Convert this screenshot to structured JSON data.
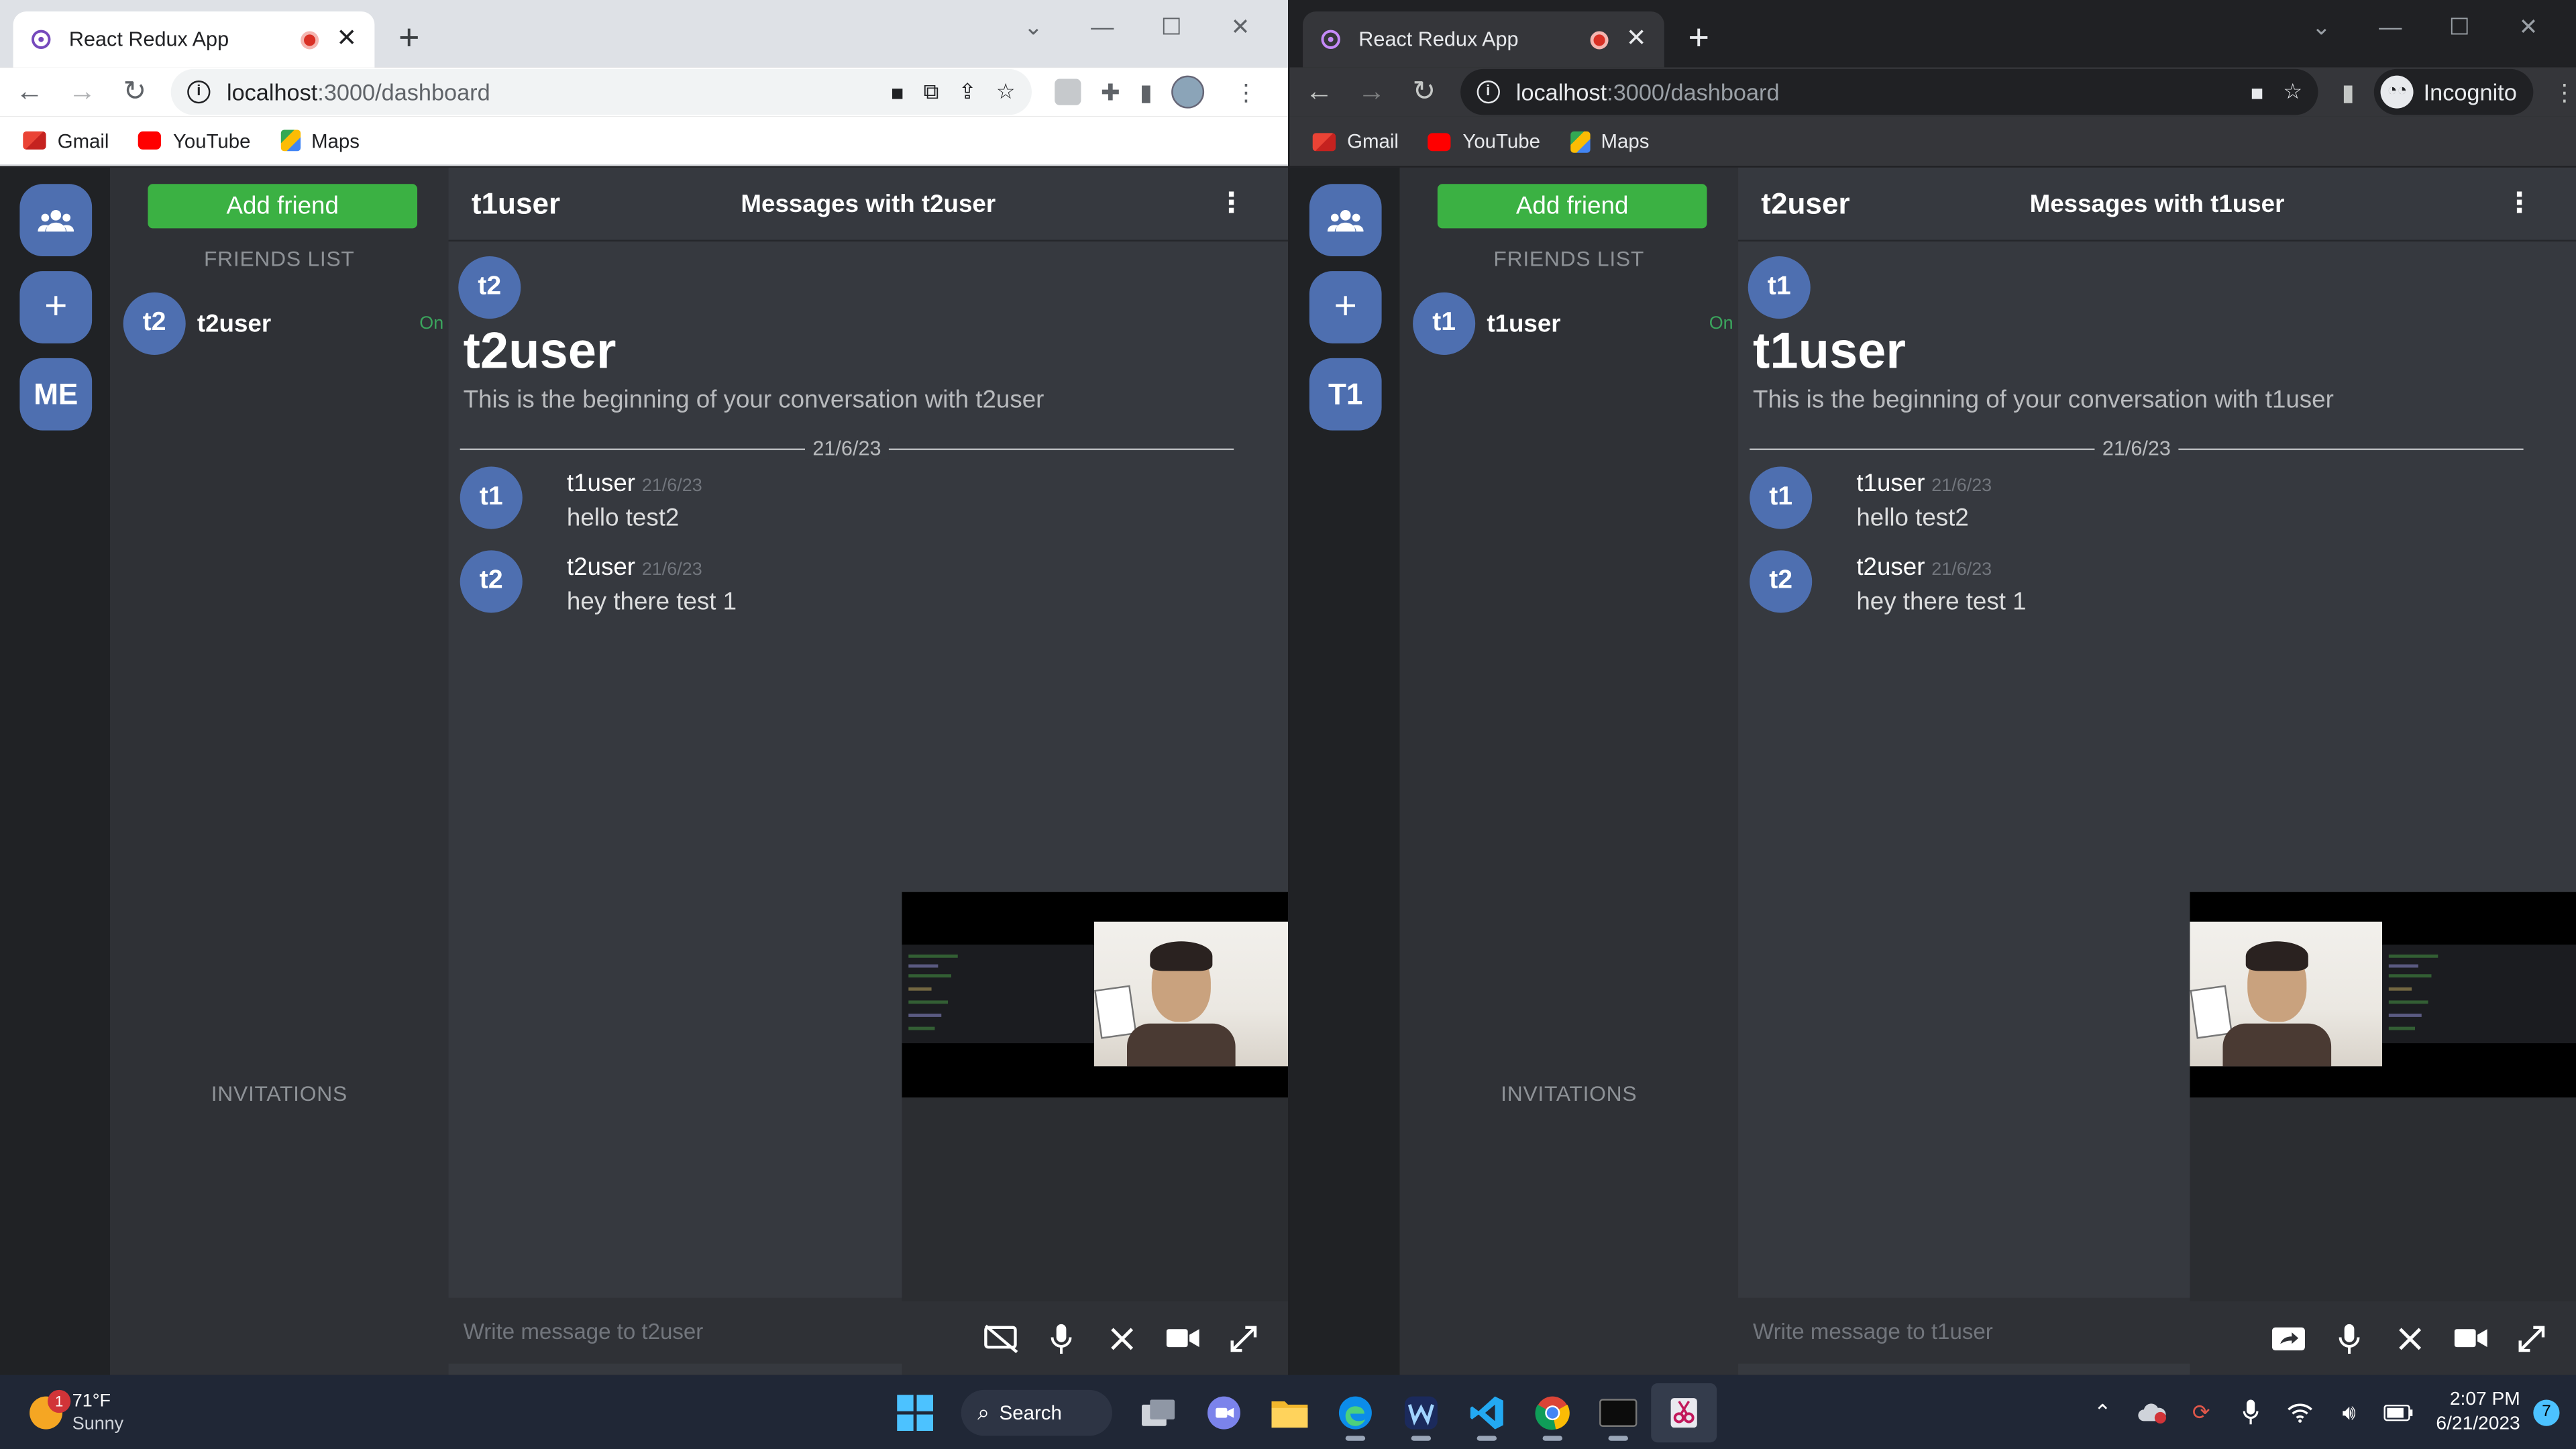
{
  "browser": [
    {
      "tab_title": "React Redux App",
      "url_host": "localhost",
      "url_path": ":3000/dashboard",
      "incognito_label": "",
      "bookmarks": [
        {
          "label": "Gmail",
          "icon": "gmail-icon"
        },
        {
          "label": "YouTube",
          "icon": "youtube-icon"
        },
        {
          "label": "Maps",
          "icon": "maps-icon"
        }
      ],
      "app": {
        "rail_me": "ME",
        "add_friend": "Add friend",
        "friends_list_title": "FRIENDS LIST",
        "friend": {
          "avatar": "t2",
          "name": "t2user",
          "status": "On"
        },
        "invitations_title": "INVITATIONS",
        "header_user": "t1user",
        "header_title": "Messages with t2user",
        "intro_avatar": "t2",
        "intro_name": "t2user",
        "intro_sub": "This is the beginning of your conversation with t2user",
        "divider_date": "21/6/23",
        "messages": [
          {
            "avatar": "t1",
            "author": "t1user",
            "date": "21/6/23",
            "text": "hello test2"
          },
          {
            "avatar": "t2",
            "author": "t2user",
            "date": "21/6/23",
            "text": "hey there test 1"
          }
        ],
        "composer_placeholder": "Write message to t2user"
      }
    },
    {
      "tab_title": "React Redux App",
      "url_host": "localhost",
      "url_path": ":3000/dashboard",
      "incognito_label": "Incognito",
      "bookmarks": [
        {
          "label": "Gmail",
          "icon": "gmail-icon"
        },
        {
          "label": "YouTube",
          "icon": "youtube-icon"
        },
        {
          "label": "Maps",
          "icon": "maps-icon"
        }
      ],
      "app": {
        "rail_me": "T1",
        "add_friend": "Add friend",
        "friends_list_title": "FRIENDS LIST",
        "friend": {
          "avatar": "t1",
          "name": "t1user",
          "status": "On"
        },
        "invitations_title": "INVITATIONS",
        "header_user": "t2user",
        "header_title": "Messages with t1user",
        "intro_avatar": "t1",
        "intro_name": "t1user",
        "intro_sub": "This is the beginning of your conversation with t1user",
        "divider_date": "21/6/23",
        "messages": [
          {
            "avatar": "t1",
            "author": "t1user",
            "date": "21/6/23",
            "text": "hello test2"
          },
          {
            "avatar": "t2",
            "author": "t2user",
            "date": "21/6/23",
            "text": "hey there test 1"
          }
        ],
        "composer_placeholder": "Write message to t1user"
      }
    }
  ],
  "taskbar": {
    "weather_temp": "71°F",
    "weather_desc": "Sunny",
    "weather_badge": "1",
    "search_label": "Search",
    "time": "2:07 PM",
    "date": "6/21/2023",
    "notification_count": "7"
  },
  "colors": {
    "accent_green": "#3bb143",
    "avatar_blue": "#4e6fb0",
    "app_bg": "#36393f",
    "sidebar_bg": "#2f3136",
    "rail_bg": "#202225",
    "online_green": "#3ba55d"
  }
}
